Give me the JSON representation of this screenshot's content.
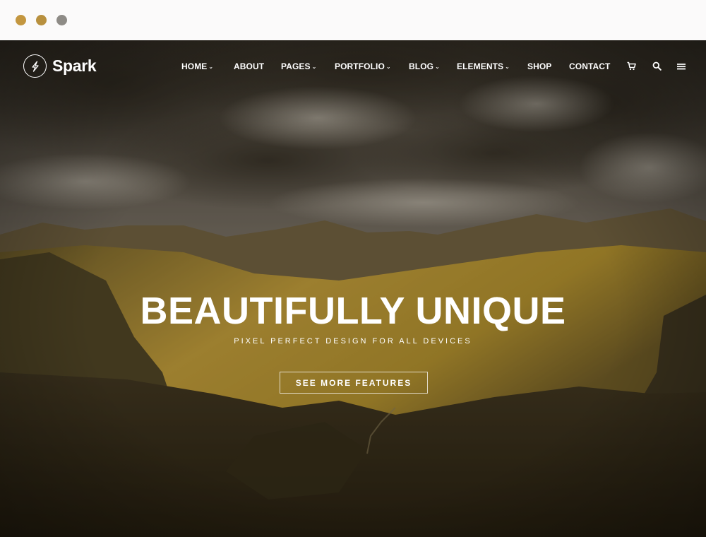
{
  "window": {
    "dots": [
      "#c3963f",
      "#b8903e",
      "#8e8b86"
    ]
  },
  "header": {
    "logo_text": "Spark",
    "logo_icon": "lightning-circle-icon"
  },
  "nav": {
    "items": [
      {
        "label": "HOME",
        "dropdown": true
      },
      {
        "label": "ABOUT",
        "dropdown": false
      },
      {
        "label": "PAGES",
        "dropdown": true
      },
      {
        "label": "PORTFOLIO",
        "dropdown": true
      },
      {
        "label": "BLOG",
        "dropdown": true
      },
      {
        "label": "ELEMENTS",
        "dropdown": true
      },
      {
        "label": "SHOP",
        "dropdown": false
      },
      {
        "label": "CONTACT",
        "dropdown": false
      }
    ],
    "caret": "⌄",
    "icons": [
      "cart-icon",
      "search-icon",
      "menu-icon"
    ]
  },
  "hero": {
    "headline": "BEAUTIFULLY UNIQUE",
    "subline": "PIXEL PERFECT DESIGN  FOR ALL DEVICES",
    "cta_label": "SEE MORE FEATURES",
    "accent_color": "#c9a23c"
  }
}
